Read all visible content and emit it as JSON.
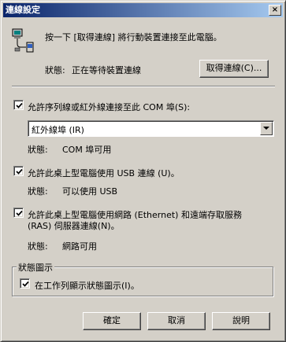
{
  "window": {
    "title": "連線設定",
    "close_glyph": "×"
  },
  "connect": {
    "description": "按一下 [取得連線] 將行動裝置連接至此電腦。",
    "status_label": "狀態:",
    "status_value": "正在等待裝置連線",
    "button_label": "取得連線(C)..."
  },
  "serial": {
    "checked": true,
    "label": "允許序列線或紅外線連接至此 COM 埠(S):",
    "selected_option": "紅外線埠 (IR)",
    "status_label": "狀態:",
    "status_value": "COM 埠可用"
  },
  "usb": {
    "checked": true,
    "label": "允許此桌上型電腦使用 USB 連線 (U)。",
    "status_label": "狀態:",
    "status_value": "可以使用 USB"
  },
  "network": {
    "checked": true,
    "label_line1": "允許此桌上型電腦使用網路 (Ethernet) 和遠端存取服務",
    "label_line2": "(RAS) 伺服器連線(N)。",
    "status_label": "狀態:",
    "status_value": "網路可用"
  },
  "status_icon_group": {
    "legend": "狀態圖示",
    "checked": true,
    "label": "在工作列顯示狀態圖示(I)。"
  },
  "footer": {
    "ok_label": "確定",
    "cancel_label": "取消",
    "help_label": "說明"
  }
}
